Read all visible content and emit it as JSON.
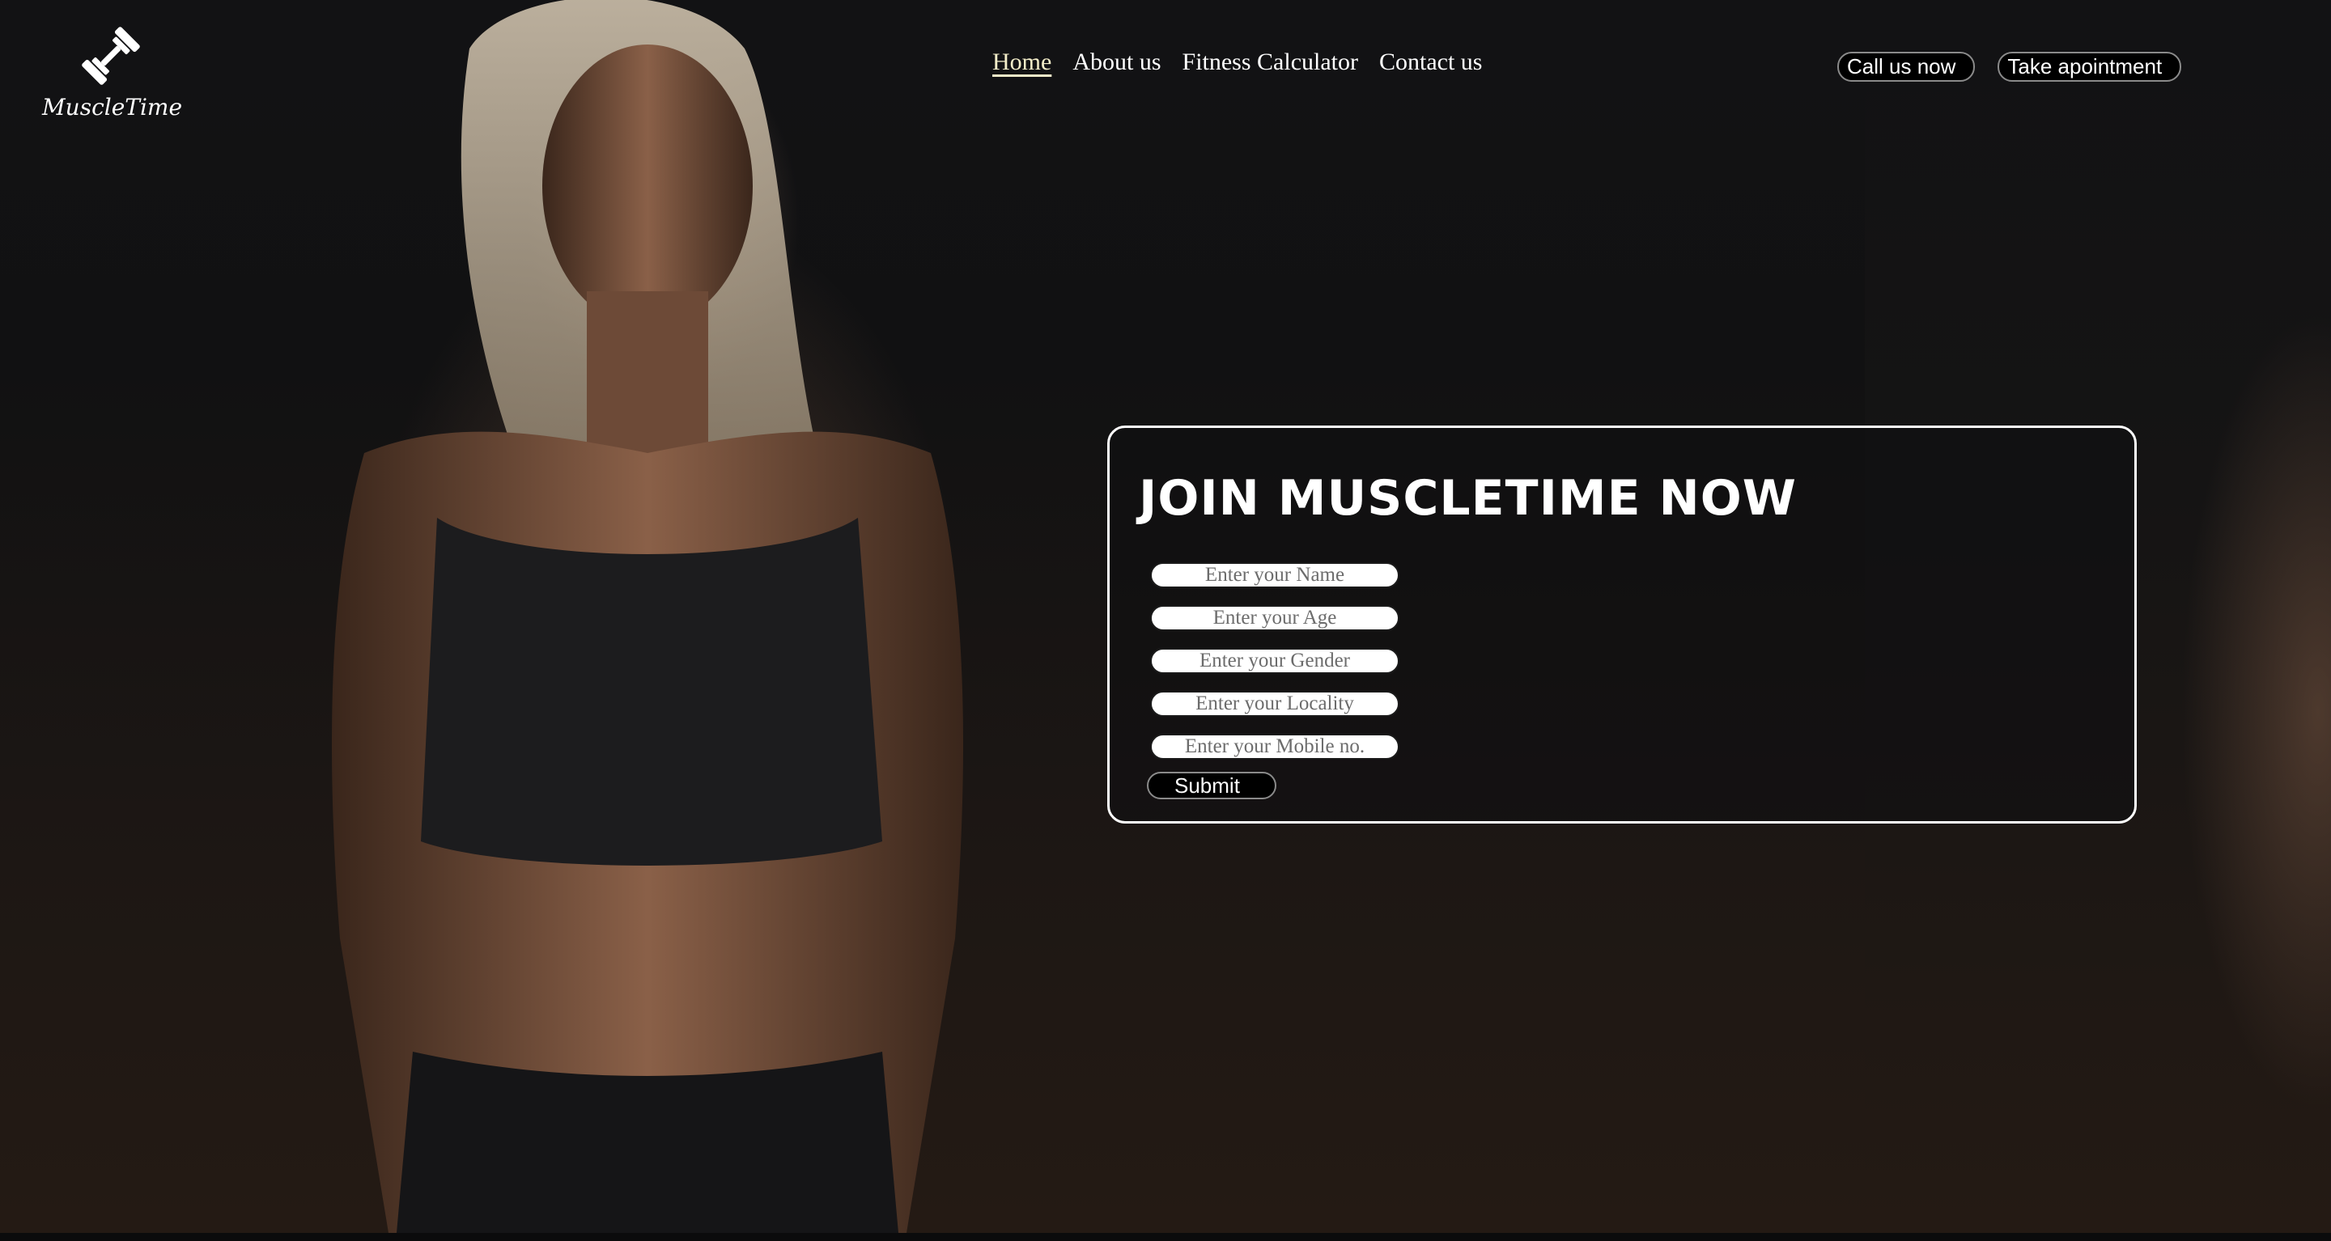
{
  "brand": {
    "name": "MuscleTime",
    "logo_icon": "dumbbell-icon"
  },
  "nav": {
    "items": [
      {
        "label": "Home",
        "active": true
      },
      {
        "label": "About us",
        "active": false
      },
      {
        "label": "Fitness Calculator",
        "active": false
      },
      {
        "label": "Contact us",
        "active": false
      }
    ]
  },
  "header_buttons": {
    "call": "Call us now",
    "appointment": "Take apointment"
  },
  "join": {
    "title": "JOIN MUSCLETIME NOW",
    "fields": {
      "name_placeholder": "Enter your Name",
      "age_placeholder": "Enter your Age",
      "gender_placeholder": "Enter your Gender",
      "locality_placeholder": "Enter your Locality",
      "mobile_placeholder": "Enter your Mobile no."
    },
    "submit_label": "Submit"
  },
  "colors": {
    "active_nav": "#f3edc9",
    "button_bg": "#000000",
    "text": "#ffffff"
  }
}
